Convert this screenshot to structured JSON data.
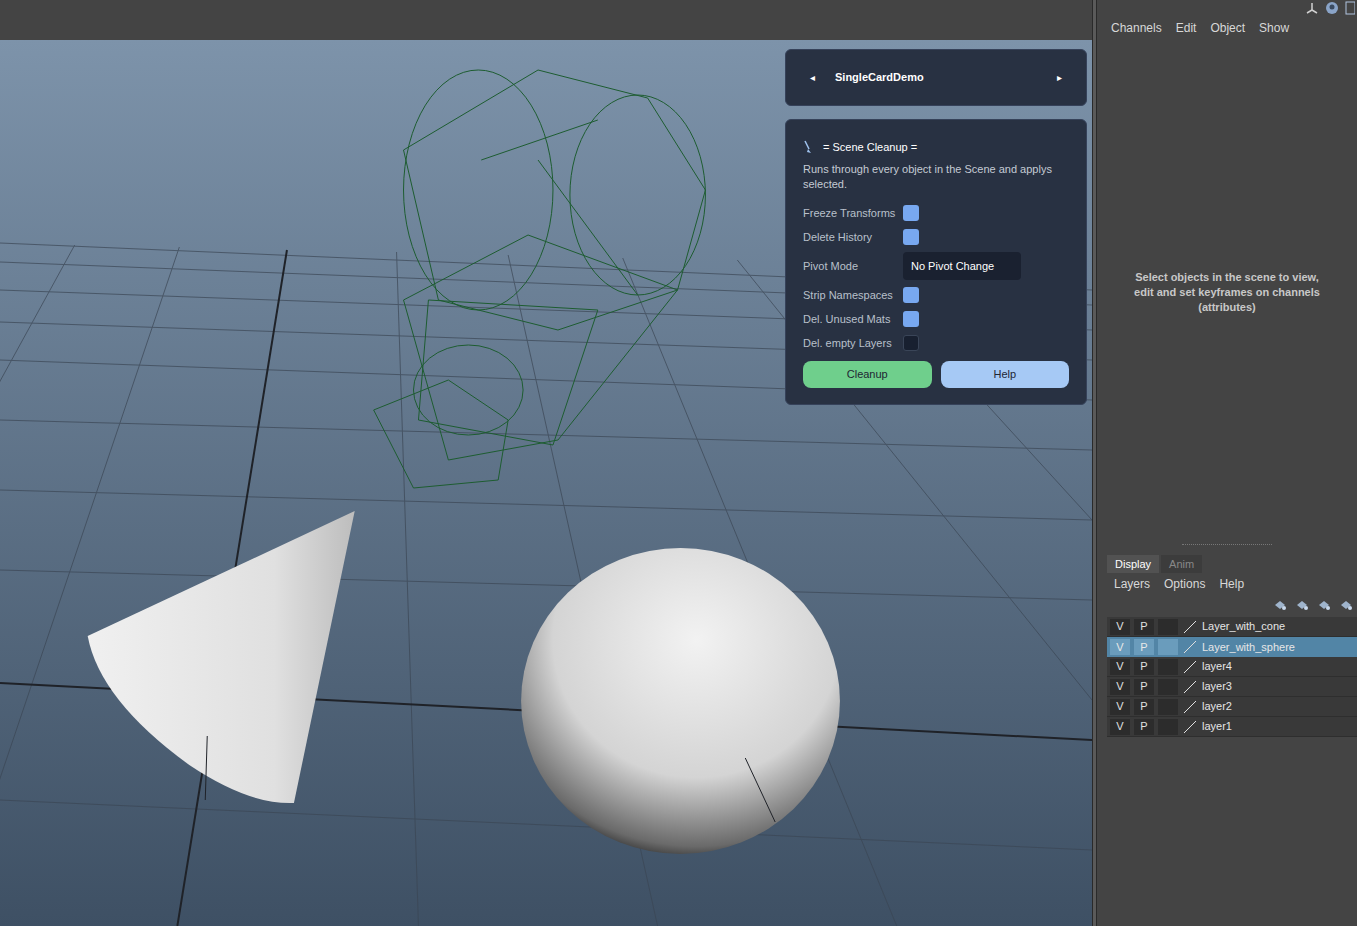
{
  "card_nav": {
    "prev": "◂",
    "title": "SingleCardDemo",
    "next": "▸"
  },
  "scene_cleanup": {
    "title": "= Scene Cleanup =",
    "description": "Runs through every object in the Scene and applys selected.",
    "options": [
      {
        "kind": "checkbox",
        "label": "Freeze Transforms",
        "checked": true
      },
      {
        "kind": "checkbox",
        "label": "Delete History",
        "checked": true
      },
      {
        "kind": "dropdown",
        "label": "Pivot Mode",
        "value": "No Pivot Change"
      },
      {
        "kind": "checkbox",
        "label": "Strip Namespaces",
        "checked": true
      },
      {
        "kind": "checkbox",
        "label": "Del. Unused Mats",
        "checked": true
      },
      {
        "kind": "checkbox",
        "label": "Del. empty Layers",
        "checked": false
      }
    ],
    "buttons": [
      {
        "label": "Cleanup",
        "color": "#6fcf8c"
      },
      {
        "label": "Help",
        "color": "#a6c9f5"
      }
    ]
  },
  "channel_box": {
    "menu": [
      "Channels",
      "Edit",
      "Object",
      "Show"
    ],
    "message": "Select objects in the scene to view, edit and set keyframes on channels (attributes)"
  },
  "layer_editor": {
    "tabs": [
      {
        "label": "Display",
        "selected": true
      },
      {
        "label": "Anim",
        "selected": false
      }
    ],
    "menu": [
      "Layers",
      "Options",
      "Help"
    ],
    "layers": [
      {
        "v": "V",
        "p": "P",
        "name": "Layer_with_cone",
        "selected": false
      },
      {
        "v": "V",
        "p": "P",
        "name": "Layer_with_sphere",
        "selected": true
      },
      {
        "v": "V",
        "p": "P",
        "name": "layer4",
        "selected": false
      },
      {
        "v": "V",
        "p": "P",
        "name": "layer3",
        "selected": false
      },
      {
        "v": "V",
        "p": "P",
        "name": "layer2",
        "selected": false
      },
      {
        "v": "V",
        "p": "P",
        "name": "layer1",
        "selected": false
      }
    ]
  }
}
